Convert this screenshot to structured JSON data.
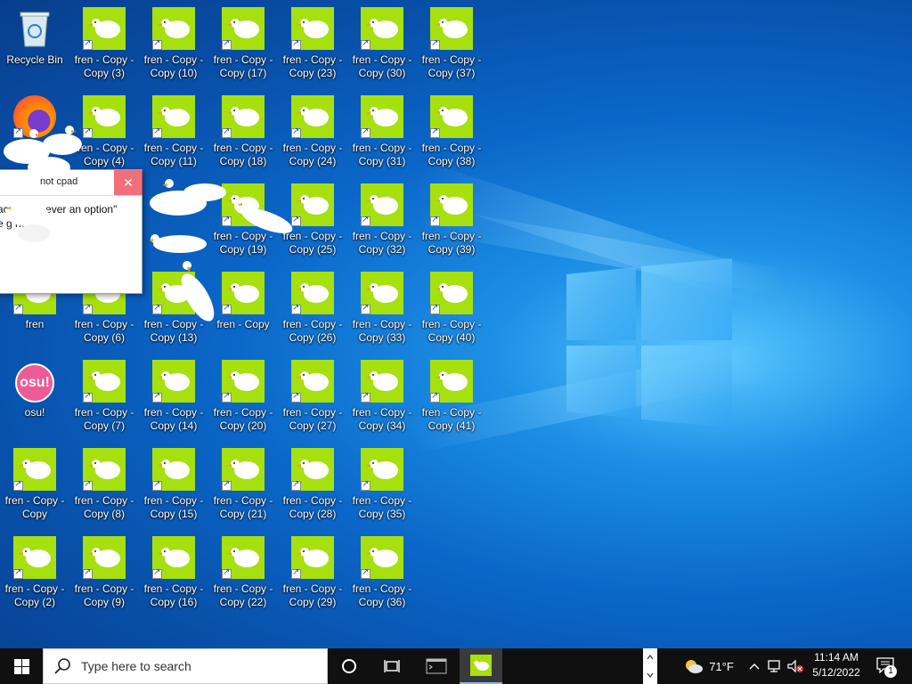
{
  "desktop": {
    "recycle_bin": {
      "label": "Recycle Bin"
    },
    "firefox": {
      "label": ""
    },
    "fren_main": {
      "label": "fren"
    },
    "osu": {
      "label": "osu!",
      "badge_text": "osu!"
    },
    "fren_copy_left": [
      {
        "label": "fren - Copy - Copy"
      },
      {
        "label": "fren - Copy - Copy (2)"
      }
    ],
    "columns": [
      [
        "fren - Copy - Copy (3)",
        "fren - Copy - Copy (4)",
        "",
        "fren - Copy - Copy (6)",
        "fren - Copy - Copy (7)",
        "fren - Copy - Copy (8)",
        "fren - Copy - Copy (9)"
      ],
      [
        "fren - Copy - Copy (10)",
        "fren - Copy - Copy (11)",
        "",
        "fren - Copy - Copy (13)",
        "fren - Copy - Copy (14)",
        "fren - Copy - Copy (15)",
        "fren - Copy - Copy (16)"
      ],
      [
        "fren - Copy - Copy (17)",
        "fren - Copy - Copy (18)",
        "fren - Copy - Copy (19)",
        "fren - Copy",
        "fren - Copy - Copy (20)",
        "fren - Copy - Copy (21)",
        "fren - Copy - Copy (22)"
      ],
      [
        "fren - Copy - Copy (23)",
        "fren - Copy - Copy (24)",
        "fren - Copy - Copy (25)",
        "fren - Copy - Copy (26)",
        "fren - Copy - Copy (27)",
        "fren - Copy - Copy (28)",
        "fren - Copy - Copy (29)"
      ],
      [
        "fren - Copy - Copy (30)",
        "fren - Copy - Copy (31)",
        "fren - Copy - Copy (32)",
        "fren - Copy - Copy (33)",
        "fren - Copy - Copy (34)",
        "fren - Copy - Copy (35)",
        "fren - Copy - Copy (36)"
      ],
      [
        "fren - Copy - Copy (37)",
        "fren - Copy - Copy (38)",
        "fren - Copy - Copy (39)",
        "fren - Copy - Copy (40)",
        "fren - Copy - Copy (41)"
      ]
    ]
  },
  "dialog": {
    "title": "not cpad",
    "message_line1": "ace was never an option\"",
    "message_line2": "e g     ne)",
    "close_glyph": "✕"
  },
  "taskbar": {
    "search_placeholder": "Type here to search",
    "weather_temp": "71°F",
    "time": "11:14 AM",
    "date": "5/12/2022",
    "notification_count": "1"
  },
  "colors": {
    "fren_icon_bg": "#a6e00e",
    "taskbar_bg": "#101010",
    "osu_pink": "#ee5a96"
  }
}
